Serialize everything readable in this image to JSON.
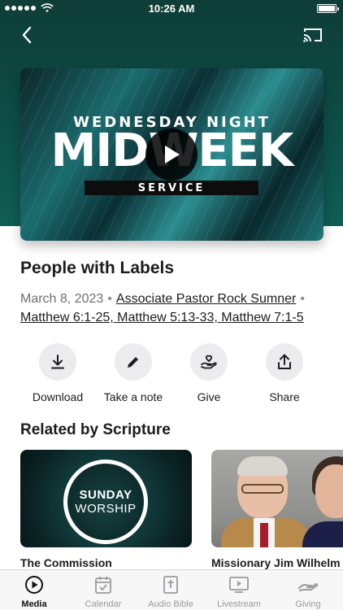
{
  "status_bar": {
    "time": "10:26 AM"
  },
  "video": {
    "title_line1": "WEDNESDAY NIGHT",
    "title_line2": "MIDWEEK",
    "title_line3": "SERVICE"
  },
  "sermon": {
    "title": "People with Labels",
    "date": "March 8, 2023",
    "separator": "•",
    "speaker": "Associate Pastor Rock Sumner",
    "scripture": "Matthew 6:1-25, Matthew 5:13-33, Matthew 7:1-5"
  },
  "actions": [
    {
      "label": "Download",
      "icon": "download-icon"
    },
    {
      "label": "Take a note",
      "icon": "pencil-icon"
    },
    {
      "label": "Give",
      "icon": "give-hand-heart-icon"
    },
    {
      "label": "Share",
      "icon": "share-icon"
    }
  ],
  "related": {
    "title": "Related by Scripture",
    "items": [
      {
        "title": "The Commission",
        "thumb_line1": "SUNDAY",
        "thumb_line2": "WORSHIP"
      },
      {
        "title": "Missionary Jim Wilhelm"
      }
    ]
  },
  "tabs": [
    {
      "label": "Media",
      "icon": "play-circle-icon",
      "active": true
    },
    {
      "label": "Calendar",
      "icon": "calendar-icon",
      "active": false
    },
    {
      "label": "Audio Bible",
      "icon": "bible-icon",
      "active": false
    },
    {
      "label": "Livestream",
      "icon": "tv-play-icon",
      "active": false
    },
    {
      "label": "Giving",
      "icon": "giving-hand-icon",
      "active": false
    }
  ],
  "colors": {
    "hero": "#0f4a43",
    "accent": "#1c1c1e",
    "muted": "#9a9a9e"
  }
}
